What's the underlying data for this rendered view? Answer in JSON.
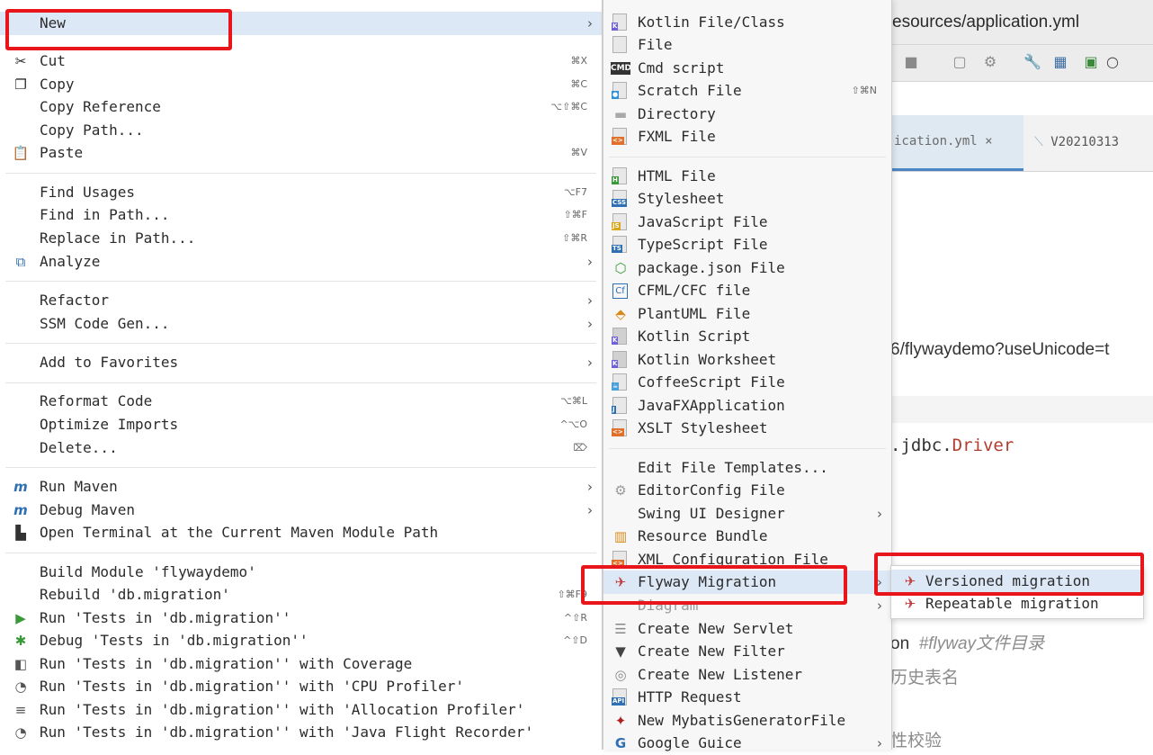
{
  "ide": {
    "title_fragment": "esources/application.yml",
    "active_tab": "ication.yml ×",
    "tab2": "V20210313",
    "code_url": "6/flywaydemo?useUnicode=t",
    "code_driver_prefix": ".jdbc.",
    "code_driver_kw": "Driver",
    "code_on": "on",
    "code_comment": "#flyway文件目录",
    "code_history": "历史表名",
    "code_check": "性校验"
  },
  "context_menu": {
    "items": [
      {
        "label": "New",
        "shortcut": "",
        "arrow": true,
        "icon": ""
      },
      {
        "label": "Cut",
        "shortcut": "⌘X",
        "icon": "scissors-icon"
      },
      {
        "label": "Copy",
        "shortcut": "⌘C",
        "icon": "copy-icon"
      },
      {
        "label": "Copy Reference",
        "shortcut": "⌥⇧⌘C",
        "icon": ""
      },
      {
        "label": "Copy Path...",
        "shortcut": "",
        "icon": ""
      },
      {
        "label": "Paste",
        "shortcut": "⌘V",
        "icon": "clipboard-icon"
      },
      {
        "label": "Find Usages",
        "shortcut": "⌥F7",
        "icon": ""
      },
      {
        "label": "Find in Path...",
        "shortcut": "⇧⌘F",
        "icon": ""
      },
      {
        "label": "Replace in Path...",
        "shortcut": "⇧⌘R",
        "icon": ""
      },
      {
        "label": "Analyze",
        "shortcut": "",
        "arrow": true,
        "icon": "analyze-icon"
      },
      {
        "label": "Refactor",
        "arrow": true
      },
      {
        "label": "SSM Code Gen...",
        "arrow": true
      },
      {
        "label": "Add to Favorites",
        "arrow": true
      },
      {
        "label": "Reformat Code",
        "shortcut": "⌥⌘L"
      },
      {
        "label": "Optimize Imports",
        "shortcut": "^⌥O"
      },
      {
        "label": "Delete...",
        "shortcut": "⌦"
      },
      {
        "label": "Run Maven",
        "arrow": true,
        "icon": "maven-run-icon"
      },
      {
        "label": "Debug Maven",
        "arrow": true,
        "icon": "maven-debug-icon"
      },
      {
        "label": "Open Terminal at the Current Maven Module Path",
        "icon": "terminal-icon"
      },
      {
        "label": "Build Module 'flywaydemo'"
      },
      {
        "label": "Rebuild 'db.migration'",
        "shortcut": "⇧⌘F9"
      },
      {
        "label": "Run 'Tests in 'db.migration''",
        "shortcut": "^⇧R",
        "icon": "run-icon"
      },
      {
        "label": "Debug 'Tests in 'db.migration''",
        "shortcut": "^⇧D",
        "icon": "debug-icon"
      },
      {
        "label": "Run 'Tests in 'db.migration'' with Coverage",
        "icon": "coverage-icon"
      },
      {
        "label": "Run 'Tests in 'db.migration'' with 'CPU Profiler'",
        "icon": "profiler-icon"
      },
      {
        "label": "Run 'Tests in 'db.migration'' with 'Allocation Profiler'",
        "icon": "allocation-icon"
      },
      {
        "label": "Run 'Tests in 'db.migration'' with 'Java Flight Recorder'",
        "icon": "flight-recorder-icon"
      }
    ]
  },
  "new_menu": {
    "items": [
      {
        "label": "Kotlin File/Class",
        "icon": "kotlin-file-icon"
      },
      {
        "label": "File",
        "icon": "file-icon"
      },
      {
        "label": "Cmd script",
        "icon": "cmd-icon"
      },
      {
        "label": "Scratch File",
        "shortcut": "⇧⌘N",
        "icon": "scratch-file-icon"
      },
      {
        "label": "Directory",
        "icon": "folder-icon"
      },
      {
        "label": "FXML File",
        "icon": "fxml-file-icon"
      },
      {
        "label": "HTML File",
        "icon": "html-file-icon"
      },
      {
        "label": "Stylesheet",
        "icon": "css-file-icon"
      },
      {
        "label": "JavaScript File",
        "icon": "js-file-icon"
      },
      {
        "label": "TypeScript File",
        "icon": "ts-file-icon"
      },
      {
        "label": "package.json File",
        "icon": "package-json-icon"
      },
      {
        "label": "CFML/CFC file",
        "icon": "cfml-icon"
      },
      {
        "label": "PlantUML File",
        "icon": "plantuml-icon"
      },
      {
        "label": "Kotlin Script",
        "icon": "kotlin-script-icon"
      },
      {
        "label": "Kotlin Worksheet",
        "icon": "kotlin-worksheet-icon"
      },
      {
        "label": "CoffeeScript File",
        "icon": "coffeescript-icon"
      },
      {
        "label": "JavaFXApplication",
        "icon": "javafx-icon"
      },
      {
        "label": "XSLT Stylesheet",
        "icon": "xslt-icon"
      },
      {
        "label": "Edit File Templates...",
        "icon": ""
      },
      {
        "label": "EditorConfig File",
        "icon": "gear-icon"
      },
      {
        "label": "Swing UI Designer",
        "arrow": true,
        "icon": ""
      },
      {
        "label": "Resource Bundle",
        "icon": "resource-bundle-icon"
      },
      {
        "label": "XML Configuration File",
        "icon": "xml-file-icon"
      },
      {
        "label": "Flyway Migration",
        "icon": "flyway-icon",
        "arrow": true
      },
      {
        "label": "Diagram",
        "icon": "",
        "arrow": true
      },
      {
        "label": "Create New Servlet",
        "icon": "servlet-icon"
      },
      {
        "label": "Create New Filter",
        "icon": "filter-icon"
      },
      {
        "label": "Create New Listener",
        "icon": "listener-icon"
      },
      {
        "label": "HTTP Request",
        "icon": "api-icon"
      },
      {
        "label": "New MybatisGeneratorFile",
        "icon": "mybatis-icon"
      },
      {
        "label": "Google Guice",
        "icon": "google-icon",
        "arrow": true
      }
    ]
  },
  "flyway_menu": {
    "items": [
      {
        "label": "Versioned migration",
        "icon": "flyway-icon"
      },
      {
        "label": "Repeatable migration",
        "icon": "flyway-icon"
      }
    ]
  },
  "colors": {
    "highlight": "#dde8f6",
    "annotation_red": "#e8161b"
  }
}
